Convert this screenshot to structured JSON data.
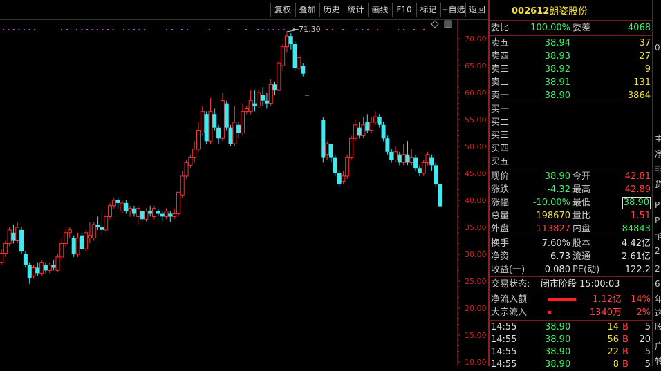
{
  "toolbar": {
    "items": [
      "复权",
      "叠加",
      "历史",
      "统计",
      "画线",
      "F10",
      "标记",
      "+自选",
      "返回"
    ]
  },
  "chart": {
    "high_marker": "71.30",
    "y_ticks": [
      "70.00",
      "65.00",
      "60.00",
      "55.00",
      "50.00",
      "45.00",
      "40.00",
      "35.00",
      "30.00",
      "25.00",
      "20.00",
      "15.00",
      "10.00"
    ],
    "colors": {
      "up": "#ff3030",
      "down": "#40e8f0",
      "axis": "#cc2222",
      "dots": "#d040d0"
    }
  },
  "chart_data": {
    "type": "candlestick",
    "ylim": [
      10,
      72
    ],
    "max_label": "71.30",
    "candles": [
      [
        28.5,
        30.2,
        28.0,
        31.0
      ],
      [
        30.2,
        32.0,
        29.5,
        32.5
      ],
      [
        32.0,
        34.5,
        31.5,
        35.0
      ],
      [
        34.0,
        32.5,
        32.0,
        35.5
      ],
      [
        32.5,
        35.0,
        32.0,
        36.0
      ],
      [
        34.5,
        30.5,
        30.0,
        35.0
      ],
      [
        30.0,
        28.0,
        27.5,
        30.5
      ],
      [
        28.0,
        25.5,
        24.5,
        28.5
      ],
      [
        26.0,
        27.5,
        25.5,
        28.0
      ],
      [
        27.5,
        26.5,
        26.0,
        28.5
      ],
      [
        26.5,
        28.5,
        26.0,
        29.0
      ],
      [
        28.0,
        27.0,
        26.5,
        28.5
      ],
      [
        27.0,
        28.0,
        26.5,
        28.5
      ],
      [
        28.0,
        27.5,
        27.0,
        29.0
      ],
      [
        27.0,
        29.5,
        26.8,
        30.0
      ],
      [
        29.5,
        32.0,
        29.0,
        33.0
      ],
      [
        32.0,
        34.0,
        31.5,
        34.5
      ],
      [
        34.0,
        34.5,
        33.0,
        35.0
      ],
      [
        33.0,
        30.0,
        29.5,
        33.5
      ],
      [
        30.0,
        33.0,
        29.5,
        34.0
      ],
      [
        33.5,
        31.0,
        31.0,
        34.0
      ],
      [
        31.0,
        34.0,
        30.5,
        34.5
      ],
      [
        33.0,
        33.5,
        32.0,
        36.0
      ],
      [
        33.0,
        35.5,
        32.5,
        36.0
      ],
      [
        35.5,
        35.0,
        34.5,
        37.0
      ],
      [
        35.0,
        34.5,
        33.5,
        38.0
      ],
      [
        34.5,
        37.0,
        34.0,
        37.5
      ],
      [
        37.0,
        39.0,
        36.5,
        39.5
      ],
      [
        39.0,
        40.0,
        38.5,
        40.5
      ],
      [
        40.0,
        39.5,
        38.5,
        40.5
      ],
      [
        38.0,
        39.5,
        37.5,
        40.0
      ],
      [
        39.5,
        38.0,
        37.5,
        40.0
      ],
      [
        38.0,
        38.5,
        37.0,
        39.0
      ],
      [
        38.5,
        37.5,
        37.0,
        39.0
      ],
      [
        37.0,
        38.5,
        35.5,
        39.0
      ],
      [
        38.0,
        36.5,
        36.0,
        38.5
      ],
      [
        36.5,
        38.0,
        36.0,
        38.5
      ],
      [
        38.0,
        37.5,
        37.0,
        39.0
      ],
      [
        37.0,
        38.5,
        36.5,
        39.0
      ],
      [
        38.0,
        37.5,
        37.0,
        38.5
      ],
      [
        37.5,
        37.0,
        36.0,
        38.0
      ],
      [
        37.0,
        38.0,
        36.5,
        38.5
      ],
      [
        37.5,
        37.0,
        36.0,
        38.0
      ],
      [
        37.0,
        37.5,
        36.5,
        38.5
      ],
      [
        37.5,
        41.5,
        37.0,
        41.5
      ],
      [
        41.0,
        44.5,
        40.5,
        45.5
      ],
      [
        44.5,
        47.0,
        44.0,
        47.5
      ],
      [
        46.5,
        48.0,
        46.0,
        48.5
      ],
      [
        48.0,
        49.5,
        47.0,
        51.0
      ],
      [
        49.5,
        53.0,
        49.0,
        54.5
      ],
      [
        52.5,
        56.5,
        52.0,
        57.5
      ],
      [
        56.0,
        51.0,
        50.5,
        56.5
      ],
      [
        51.0,
        56.5,
        50.5,
        59.0
      ],
      [
        56.0,
        53.5,
        53.0,
        57.0
      ],
      [
        53.5,
        51.5,
        50.5,
        54.0
      ],
      [
        51.5,
        58.5,
        51.0,
        60.0
      ],
      [
        58.0,
        53.5,
        53.0,
        58.5
      ],
      [
        53.5,
        50.5,
        50.0,
        54.0
      ],
      [
        50.5,
        54.5,
        50.0,
        57.5
      ],
      [
        54.0,
        52.5,
        51.5,
        54.5
      ],
      [
        52.5,
        56.5,
        52.0,
        58.0
      ],
      [
        56.5,
        57.0,
        56.0,
        57.5
      ],
      [
        56.5,
        58.5,
        56.0,
        60.5
      ],
      [
        58.0,
        57.5,
        56.5,
        60.5
      ],
      [
        57.5,
        60.0,
        57.0,
        60.5
      ],
      [
        59.5,
        58.5,
        57.5,
        61.0
      ],
      [
        58.5,
        58.0,
        57.0,
        60.0
      ],
      [
        58.0,
        61.5,
        57.5,
        62.5
      ],
      [
        61.5,
        60.5,
        59.5,
        62.0
      ],
      [
        60.5,
        65.5,
        60.0,
        66.0
      ],
      [
        65.0,
        68.5,
        64.0,
        69.0
      ],
      [
        68.5,
        70.5,
        67.5,
        71.3
      ],
      [
        70.5,
        69.0,
        68.0,
        71.0
      ],
      [
        69.0,
        64.5,
        64.0,
        69.5
      ],
      [
        64.5,
        66.5,
        64.0,
        67.0
      ],
      [
        65.0,
        63.5,
        63.0,
        65.5
      ],
      [
        0,
        0,
        0,
        0
      ],
      [
        0,
        0,
        0,
        0
      ],
      [
        0,
        0,
        0,
        0
      ],
      [
        0,
        0,
        0,
        0
      ],
      [
        55.0,
        48.0,
        47.0,
        55.5
      ],
      [
        48.5,
        50.5,
        47.5,
        51.0
      ],
      [
        50.5,
        48.0,
        47.0,
        50.5
      ],
      [
        48.0,
        45.0,
        44.5,
        48.5
      ],
      [
        45.0,
        43.0,
        42.5,
        45.5
      ],
      [
        43.5,
        44.5,
        43.0,
        45.5
      ],
      [
        44.5,
        48.0,
        44.0,
        48.5
      ],
      [
        48.0,
        51.5,
        47.5,
        52.0
      ],
      [
        51.5,
        54.0,
        51.0,
        55.0
      ],
      [
        53.5,
        52.0,
        51.5,
        54.5
      ],
      [
        52.0,
        54.0,
        51.5,
        55.5
      ],
      [
        54.5,
        53.0,
        52.5,
        56.0
      ],
      [
        53.0,
        54.5,
        52.5,
        55.5
      ],
      [
        54.5,
        55.5,
        54.0,
        56.5
      ],
      [
        55.5,
        54.0,
        53.5,
        56.0
      ],
      [
        54.0,
        51.5,
        51.0,
        54.5
      ],
      [
        51.5,
        49.0,
        48.5,
        52.0
      ],
      [
        49.0,
        47.5,
        47.0,
        49.5
      ],
      [
        47.5,
        49.0,
        47.0,
        50.0
      ],
      [
        48.5,
        47.0,
        46.5,
        49.0
      ],
      [
        47.0,
        48.5,
        46.5,
        50.5
      ],
      [
        48.5,
        47.0,
        46.5,
        51.0
      ],
      [
        47.0,
        48.0,
        46.5,
        49.5
      ],
      [
        48.0,
        46.0,
        45.5,
        48.5
      ],
      [
        46.0,
        45.0,
        44.5,
        46.5
      ],
      [
        45.0,
        47.0,
        44.5,
        47.5
      ],
      [
        47.0,
        48.5,
        46.5,
        49.0
      ],
      [
        48.0,
        46.5,
        45.5,
        48.5
      ],
      [
        46.5,
        43.0,
        42.5,
        47.0
      ],
      [
        43.0,
        38.9,
        38.9,
        43.0
      ]
    ],
    "gap_markers": [
      {
        "index": 76,
        "price": 59.5
      },
      {
        "index": 80,
        "price": 51.2
      }
    ]
  },
  "quote": {
    "code": "002612",
    "name": "朗姿股份",
    "weibi_label": "委比",
    "weibi_value": "-100.00%",
    "weicha_label": "委差",
    "weicha_value": "-4068",
    "asks": [
      {
        "label": "卖五",
        "price": "38.94",
        "vol": "37"
      },
      {
        "label": "卖四",
        "price": "38.93",
        "vol": "27"
      },
      {
        "label": "卖三",
        "price": "38.92",
        "vol": "9"
      },
      {
        "label": "卖二",
        "price": "38.91",
        "vol": "131"
      },
      {
        "label": "卖一",
        "price": "38.90",
        "vol": "3864"
      }
    ],
    "bids": [
      {
        "label": "买一"
      },
      {
        "label": "买二"
      },
      {
        "label": "买三"
      },
      {
        "label": "买四"
      },
      {
        "label": "买五"
      }
    ],
    "stats": [
      {
        "l1": "现价",
        "v1": "38.90",
        "c1": "g",
        "l2": "今开",
        "v2": "42.81",
        "c2": "r"
      },
      {
        "l1": "涨跌",
        "v1": "-4.32",
        "c1": "g",
        "l2": "最高",
        "v2": "42.89",
        "c2": "r"
      },
      {
        "l1": "涨幅",
        "v1": "-10.00%",
        "c1": "g",
        "l2": "最低",
        "v2": "38.90",
        "c2": "g"
      },
      {
        "l1": "总量",
        "v1": "198670",
        "c1": "y",
        "l2": "量比",
        "v2": "1.51",
        "c2": "r"
      },
      {
        "l1": "外盘",
        "v1": "113827",
        "c1": "r",
        "l2": "内盘",
        "v2": "84843",
        "c2": "g"
      }
    ],
    "fund": [
      {
        "l1": "换手",
        "v1": "7.60%",
        "l2": "股本",
        "v2": "4.42亿"
      },
      {
        "l1": "净资",
        "v1": "6.73",
        "l2": "流通",
        "v2": "2.61亿"
      },
      {
        "l1": "收益(一)",
        "v1": "0.080",
        "l2": "PE(动)",
        "v2": "122.2"
      }
    ],
    "trade_status_label": "交易状态:",
    "trade_status_value": "闭市阶段 15:00:03",
    "flows": [
      {
        "label": "净流入额",
        "value": "1.12亿",
        "pct": "14%",
        "bar": 0.9
      },
      {
        "label": "大宗流入",
        "value": "1340万",
        "pct": "2%",
        "bar": 0.1
      }
    ],
    "ticks": [
      {
        "time": "14:55",
        "price": "38.90",
        "vol": "14",
        "side": "B",
        "n": "5"
      },
      {
        "time": "14:55",
        "price": "38.90",
        "vol": "56",
        "side": "B",
        "n": "20"
      },
      {
        "time": "14:55",
        "price": "38.90",
        "vol": "22",
        "side": "B",
        "n": "5"
      },
      {
        "time": "14:55",
        "price": "38.90",
        "vol": "8",
        "side": "B",
        "n": "5"
      }
    ]
  },
  "edge": {
    "chars": [
      "0",
      "主",
      "净",
      "非",
      "货",
      "P",
      "P",
      "毛",
      "2",
      "2",
      "6",
      "年",
      "这",
      "股",
      "广",
      "转"
    ]
  }
}
